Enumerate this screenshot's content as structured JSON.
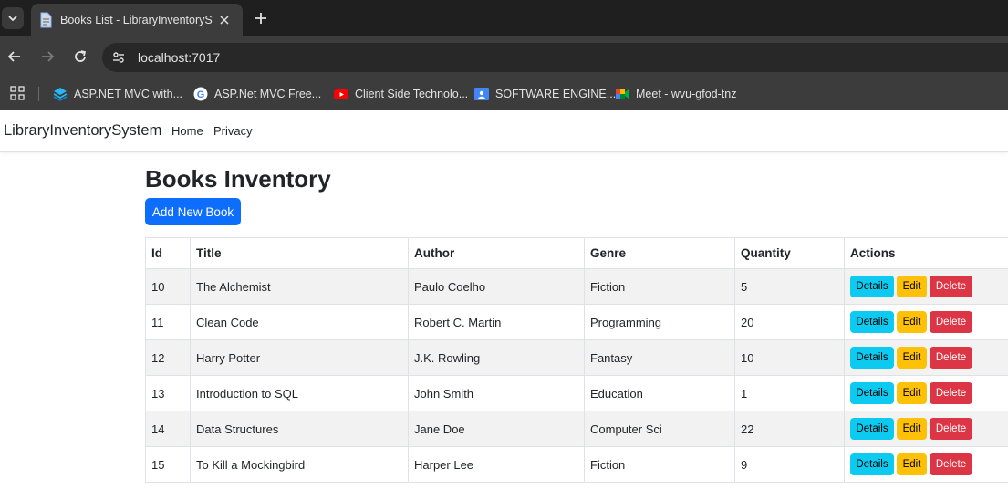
{
  "browser": {
    "tab_title": "Books List - LibraryInventorySys",
    "url": "localhost:7017",
    "bookmarks": [
      {
        "label": "ASP.NET MVC with...",
        "icon": "layers-icon"
      },
      {
        "label": "ASP.Net MVC Free...",
        "icon": "google-icon"
      },
      {
        "label": "Client Side Technolo...",
        "icon": "youtube-icon"
      },
      {
        "label": "SOFTWARE ENGINE...",
        "icon": "classroom-icon"
      },
      {
        "label": "Meet - wvu-gfod-tnz",
        "icon": "meet-icon"
      }
    ]
  },
  "navbar": {
    "brand": "LibraryInventorySystem",
    "links": [
      "Home",
      "Privacy"
    ]
  },
  "page": {
    "title": "Books Inventory",
    "add_button": "Add New Book"
  },
  "table": {
    "headers": [
      "Id",
      "Title",
      "Author",
      "Genre",
      "Quantity",
      "Actions"
    ],
    "rows": [
      {
        "id": "10",
        "title": "The Alchemist",
        "author": "Paulo Coelho",
        "genre": "Fiction",
        "quantity": "5"
      },
      {
        "id": "11",
        "title": "Clean Code",
        "author": "Robert C. Martin",
        "genre": "Programming",
        "quantity": "20"
      },
      {
        "id": "12",
        "title": "Harry Potter",
        "author": "J.K. Rowling",
        "genre": "Fantasy",
        "quantity": "10"
      },
      {
        "id": "13",
        "title": "Introduction to SQL",
        "author": "John Smith",
        "genre": "Education",
        "quantity": "1"
      },
      {
        "id": "14",
        "title": "Data Structures",
        "author": "Jane Doe",
        "genre": "Computer Sci",
        "quantity": "22"
      },
      {
        "id": "15",
        "title": "To Kill a Mockingbird",
        "author": "Harper Lee",
        "genre": "Fiction",
        "quantity": "9"
      }
    ],
    "actions": {
      "details": "Details",
      "edit": "Edit",
      "delete": "Delete"
    }
  },
  "colors": {
    "primary": "#0d6efd",
    "info": "#0dcaf0",
    "warning": "#ffc107",
    "danger": "#dc3545"
  }
}
